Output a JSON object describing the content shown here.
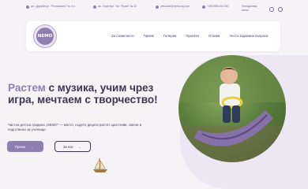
{
  "topbar": {
    "address1": "ж.к. Дружба ул. \"Респитиата\" № 3 а",
    "address2": "жк. Хора бул. \"Ал. Русев\" № 22",
    "email": "welcome@nemo-kg.com",
    "phone": "+359 898 000 000",
    "hours": "Понеделник-петък"
  },
  "nav": {
    "logo_text": "NEMO",
    "items": [
      "За сазвелиото",
      "Прием",
      "Галерия",
      "Проекти",
      "Отзиви",
      "Често задавани въпроси"
    ]
  },
  "hero": {
    "headline_highlight": "Растем",
    "headline_rest": " с музика, учим чрез игра, мечтаем с творчество!",
    "subtext": "Частна детска градина „NEMO“ — място, където децата растат щастливи, смели и подготвени за училище.",
    "primary_button": "Прием",
    "secondary_button": "За нас"
  },
  "colors": {
    "accent": "#8f7fb1",
    "background": "#f6f3f7",
    "text": "#3c3550"
  }
}
